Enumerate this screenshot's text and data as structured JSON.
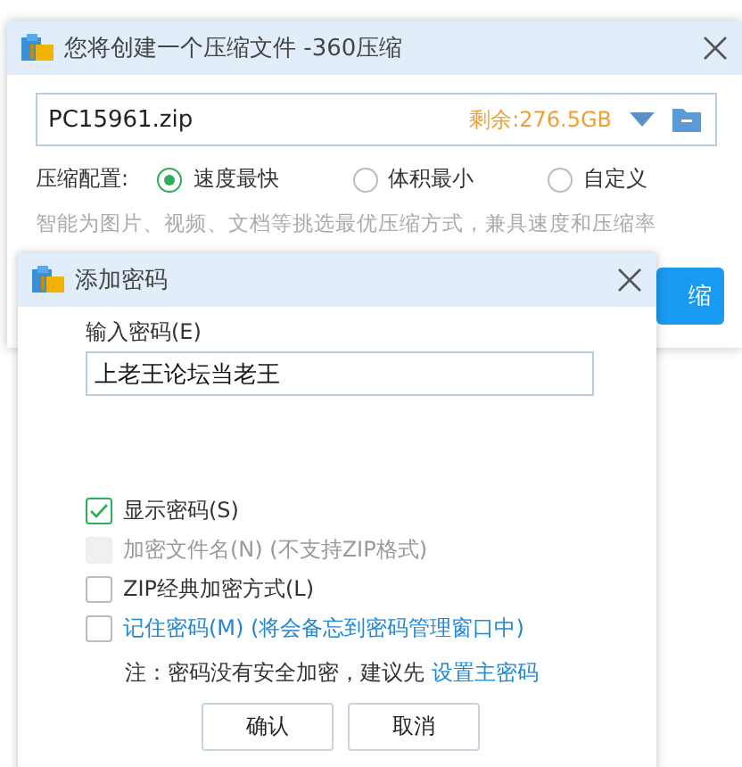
{
  "main_window": {
    "title": "您将创建一个压缩文件 -360压缩",
    "path_field": {
      "value": "PC15961.zip",
      "free_space": "剩余:276.5GB"
    },
    "config": {
      "label": "压缩配置:",
      "options": [
        {
          "label": "速度最快",
          "selected": true
        },
        {
          "label": "体积最小",
          "selected": false
        },
        {
          "label": "自定义",
          "selected": false
        }
      ]
    },
    "hint": "智能为图片、视频、文档等挑选最优压缩方式，兼具速度和压缩率",
    "compress_button": "缩"
  },
  "dialog": {
    "title": "添加密码",
    "password_label": "输入密码(E)",
    "password_value": "上老王论坛当老王",
    "options": [
      {
        "kind": "plain",
        "label": "显示密码(S)",
        "checked": true,
        "disabled": false
      },
      {
        "kind": "plain",
        "label": "加密文件名(N) (不支持ZIP格式)",
        "checked": false,
        "disabled": true
      },
      {
        "kind": "plain",
        "label": "ZIP经典加密方式(L)",
        "checked": false,
        "disabled": false
      },
      {
        "kind": "link",
        "label": "记住密码(M) (将会备忘到密码管理窗口中)",
        "checked": false,
        "disabled": false
      }
    ],
    "note": "注：密码没有安全加密，建议先",
    "note_link": "设置主密码",
    "buttons": [
      "确认",
      "取消"
    ]
  }
}
